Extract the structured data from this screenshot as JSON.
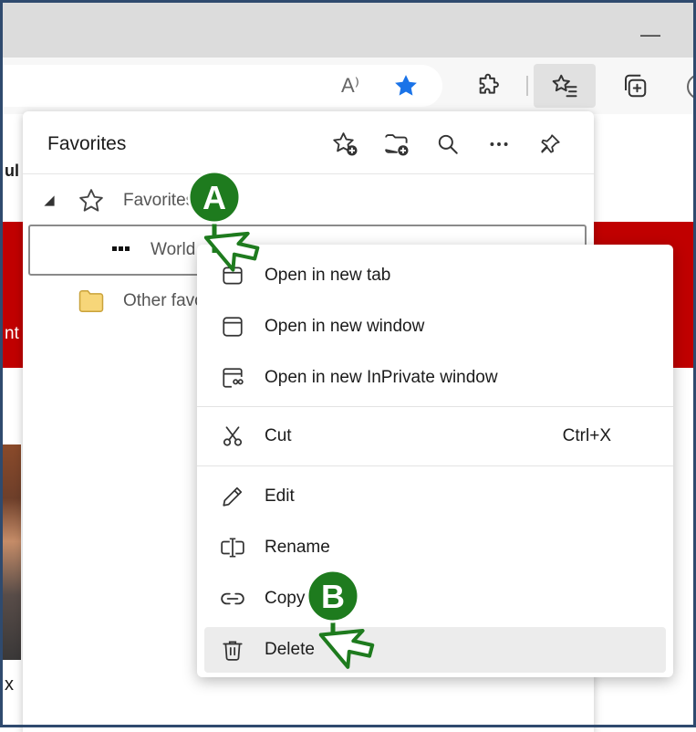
{
  "browser": {
    "minimize_glyph": "—",
    "read_aloud_glyph": "A⁾"
  },
  "favorites_panel": {
    "title": "Favorites",
    "actions": [
      "add-favorite-icon",
      "add-folder-icon",
      "search-icon",
      "more-icon",
      "pin-icon"
    ],
    "tree": [
      {
        "label": "Favorites bar",
        "icon": "star-outline-icon"
      },
      {
        "label": "World",
        "icon": "site-favicon-icon"
      },
      {
        "label": "Other favorites",
        "icon": "folder-icon"
      }
    ]
  },
  "page_fragments": {
    "top_text": "ul",
    "red_text": "nt",
    "bottom_text": "x"
  },
  "context_menu": {
    "items": [
      {
        "label": "Open in new tab",
        "icon": "new-tab-icon",
        "shortcut": ""
      },
      {
        "label": "Open in new window",
        "icon": "new-window-icon",
        "shortcut": ""
      },
      {
        "label": "Open in new InPrivate window",
        "icon": "inprivate-window-icon",
        "shortcut": ""
      },
      {
        "label": "Cut",
        "icon": "scissors-icon",
        "shortcut": "Ctrl+X"
      },
      {
        "label": "Edit",
        "icon": "pencil-icon",
        "shortcut": ""
      },
      {
        "label": "Rename",
        "icon": "rename-icon",
        "shortcut": ""
      },
      {
        "label": "Copy",
        "icon": "link-icon",
        "shortcut": ""
      },
      {
        "label": "Delete",
        "icon": "trash-icon",
        "shortcut": ""
      }
    ]
  },
  "callouts": [
    {
      "letter": "A",
      "color": "#1e7b1e"
    },
    {
      "letter": "B",
      "color": "#1e7b1e"
    }
  ],
  "colors": {
    "accent_blue": "#1a73e8",
    "callout_green": "#1e7b1e",
    "banner_red": "#c00000"
  }
}
